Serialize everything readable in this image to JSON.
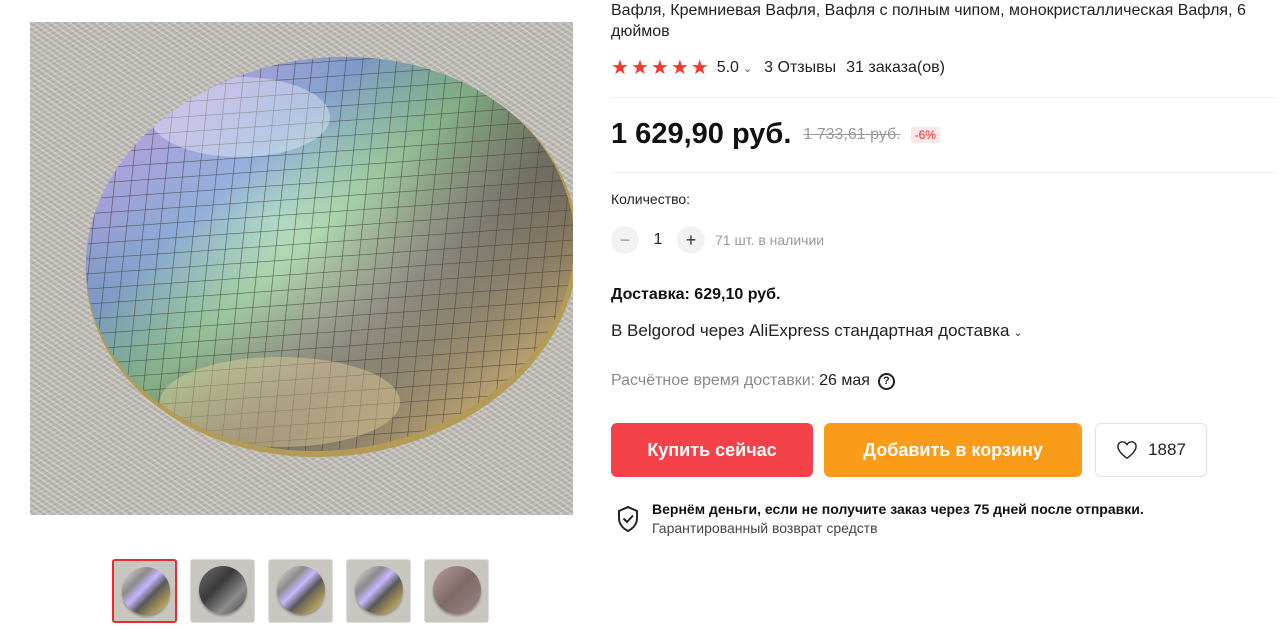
{
  "product": {
    "title": "Вафля, Кремниевая Вафля, Вафля с полным чипом, монокристаллическая Вафля, 6 дюймов",
    "rating": "5.0",
    "reviews": "3 Отзывы",
    "orders": "31 заказа(ов)",
    "star_color": "#f5392f"
  },
  "price": {
    "current": "1 629,90 руб.",
    "old": "1 733,61 руб.",
    "discount": "-6%"
  },
  "quantity": {
    "label": "Количество:",
    "minus": "−",
    "value": "1",
    "plus": "+",
    "stock": "71 шт. в наличии"
  },
  "delivery": {
    "title": "Доставка: 629,10 руб.",
    "route": "В Belgorod через AliExpress стандартная доставка",
    "eta_label": "Расчётное время доставки:",
    "eta_date": "26 мая",
    "help": "?"
  },
  "actions": {
    "buy_label": "Купить сейчас",
    "buy_color": "#f5414a",
    "cart_label": "Добавить в корзину",
    "cart_color": "#fb9b1a",
    "wishlist_count": "1887"
  },
  "guarantee": {
    "line1": "Вернём деньги, если не получите заказ через 75 дней после отправки.",
    "line2": "Гарантированный возврат средств"
  },
  "gallery": {
    "thumbnails": [
      "wafer-photo-1",
      "wafer-photo-2",
      "wafer-photo-3",
      "wafer-photo-4",
      "wafer-photo-5"
    ],
    "active_index": 0
  }
}
